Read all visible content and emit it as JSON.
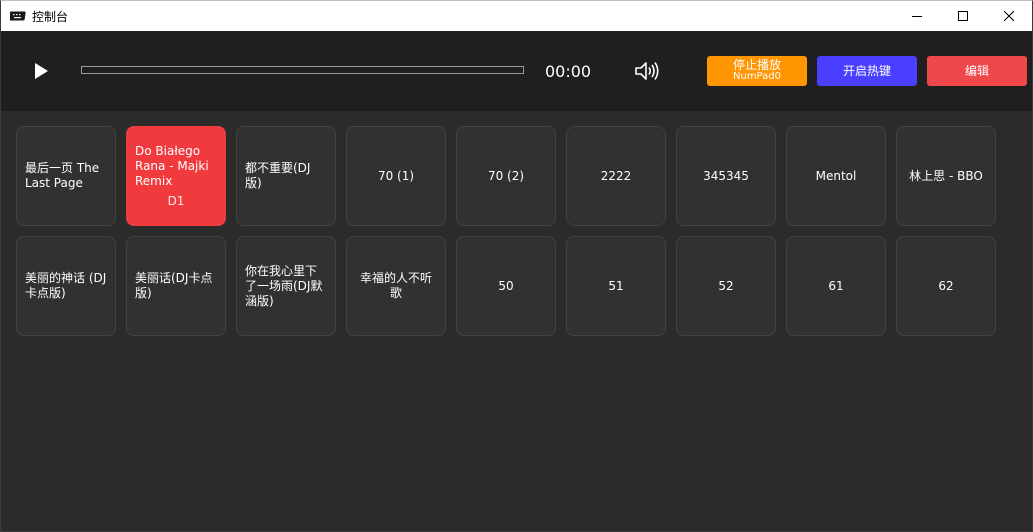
{
  "window": {
    "title": "控制台"
  },
  "player": {
    "time": "00:00",
    "progress": 0,
    "buttons": {
      "stop_label": "停止播放",
      "stop_hotkey": "NumPad0",
      "hotkey_label": "开启热键",
      "edit_label": "编辑"
    }
  },
  "tracks": [
    {
      "name": "最后一页 The Last Page",
      "align": "left",
      "active": false
    },
    {
      "name": "Do Białego Rana - Majki Remix",
      "hotkey": "D1",
      "align": "left",
      "active": true
    },
    {
      "name": "都不重要(DJ版)",
      "align": "left",
      "active": false
    },
    {
      "name": "70 (1)",
      "align": "center",
      "active": false
    },
    {
      "name": "70 (2)",
      "align": "center",
      "active": false
    },
    {
      "name": "2222",
      "align": "center",
      "active": false
    },
    {
      "name": "345345",
      "align": "center",
      "active": false
    },
    {
      "name": "Mentol",
      "align": "center",
      "active": false
    },
    {
      "name": "林上思 - BBO",
      "align": "center",
      "active": false
    },
    {
      "name": "美丽的神话 (DJ卡点版)",
      "align": "left",
      "active": false
    },
    {
      "name": "美丽话(DJ卡点版)",
      "align": "left",
      "active": false
    },
    {
      "name": "你在我心里下了一场雨(DJ默涵版)",
      "align": "left",
      "active": false
    },
    {
      "name": "幸福的人不听歌",
      "align": "center",
      "active": false
    },
    {
      "name": "50",
      "align": "center",
      "active": false
    },
    {
      "name": "51",
      "align": "center",
      "active": false
    },
    {
      "name": "52",
      "align": "center",
      "active": false
    },
    {
      "name": "61",
      "align": "center",
      "active": false
    },
    {
      "name": "62",
      "align": "center",
      "active": false
    }
  ],
  "colors": {
    "stop": "#ff9500",
    "hotkey": "#4a3fff",
    "edit": "#f0474a",
    "active_tile": "#f03a3e",
    "tile": "#313131"
  },
  "icons": {
    "app": "keyboard-icon",
    "play": "play-icon",
    "volume": "volume-icon",
    "minimize": "minimize-icon",
    "maximize": "maximize-icon",
    "close": "close-icon"
  }
}
